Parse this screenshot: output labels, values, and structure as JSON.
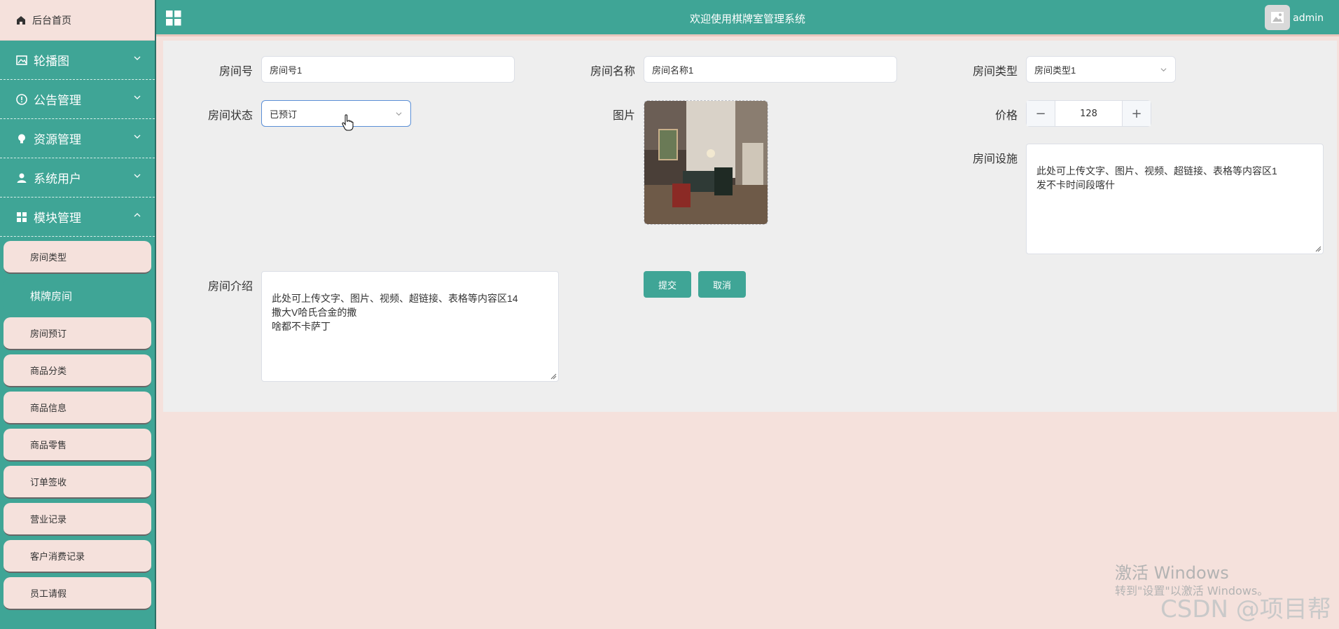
{
  "sidebar": {
    "home": "后台首页",
    "menus": [
      {
        "label": "轮播图",
        "icon": "image-icon"
      },
      {
        "label": "公告管理",
        "icon": "info-icon"
      },
      {
        "label": "资源管理",
        "icon": "bulb-icon"
      },
      {
        "label": "系统用户",
        "icon": "user-icon"
      },
      {
        "label": "模块管理",
        "icon": "grid-icon"
      }
    ],
    "subitems": [
      "房间类型",
      "棋牌房间",
      "房间预订",
      "商品分类",
      "商品信息",
      "商品零售",
      "订单签收",
      "营业记录",
      "客户消费记录",
      "员工请假"
    ],
    "active_subitem": "棋牌房间"
  },
  "header": {
    "title": "欢迎使用棋牌室管理系统",
    "user": "admin"
  },
  "form": {
    "room_no": {
      "label": "房间号",
      "value": "房间号1"
    },
    "room_name": {
      "label": "房间名称",
      "value": "房间名称1"
    },
    "room_type": {
      "label": "房间类型",
      "value": "房间类型1"
    },
    "room_status": {
      "label": "房间状态",
      "value": "已预订"
    },
    "picture": {
      "label": "图片"
    },
    "price": {
      "label": "价格",
      "value": "128",
      "minus": "−",
      "plus": "+"
    },
    "facilities": {
      "label": "房间设施",
      "value": "此处可上传文字、图片、视频、超链接、表格等内容区1\n发不卡时间段喀什"
    },
    "intro": {
      "label": "房间介绍",
      "value": "此处可上传文字、图片、视频、超链接、表格等内容区14\n撒大V哈氏合金的撒\n啥都不卡萨丁"
    },
    "submit": "提交",
    "cancel": "取消"
  },
  "watermark": {
    "line1": "激活 Windows",
    "line2": "转到\"设置\"以激活 Windows。",
    "csdn": "CSDN @项目帮"
  },
  "colors": {
    "accent": "#3fa596",
    "background": "#f5e1dc"
  }
}
